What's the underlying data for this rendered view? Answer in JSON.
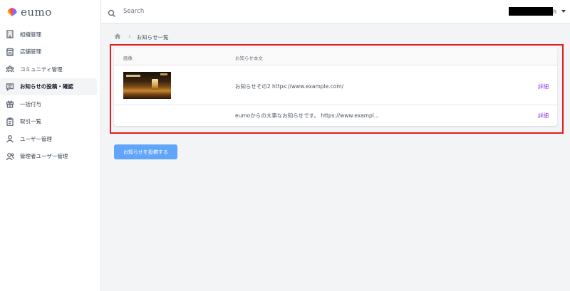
{
  "app": {
    "brand": "eumo"
  },
  "sidebar": {
    "items": [
      {
        "label": "組織管理",
        "icon": "building-icon",
        "active": false
      },
      {
        "label": "店舗管理",
        "icon": "store-icon",
        "active": false
      },
      {
        "label": "コミュニティ管理",
        "icon": "community-icon",
        "active": false
      },
      {
        "label": "お知らせの投稿・確認",
        "icon": "message-icon",
        "active": true
      },
      {
        "label": "一括付与",
        "icon": "gift-icon",
        "active": false
      },
      {
        "label": "取引一覧",
        "icon": "clipboard-icon",
        "active": false
      },
      {
        "label": "ユーザー管理",
        "icon": "users-icon",
        "active": false
      },
      {
        "label": "管理者ユーザー管理",
        "icon": "admin-users-icon",
        "active": false
      }
    ]
  },
  "topbar": {
    "search_placeholder": "Search",
    "user_suffix": "h"
  },
  "breadcrumb": {
    "home_icon": "home-icon",
    "current": "お知らせ一覧"
  },
  "table": {
    "columns": {
      "image": "画像",
      "body": "お知らせ本文"
    },
    "rows": [
      {
        "has_image": true,
        "body": "お知らせその2 https://www.example.com/",
        "action": "詳細"
      },
      {
        "has_image": false,
        "body": "eumoからの大事なお知らせです。 https://www.exampl...",
        "action": "詳細"
      }
    ]
  },
  "actions": {
    "post_label": "お知らせを投稿する"
  },
  "colors": {
    "accent": "#60a5fa",
    "link": "#9333ea",
    "highlight": "#e11d1d"
  }
}
